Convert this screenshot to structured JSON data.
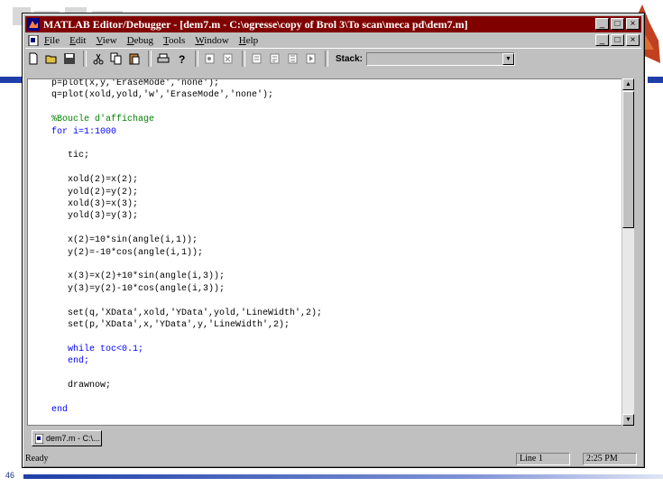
{
  "window": {
    "title": "MATLAB Editor/Debugger - [dem7.m - C:\\ogresse\\copy of Brol 3\\To scan\\meca pd\\dem7.m]",
    "controls": [
      "_",
      "□",
      "×"
    ],
    "doc_controls": [
      "_",
      "□",
      "×"
    ]
  },
  "menu": {
    "items": [
      {
        "first": "F",
        "rest": "ile"
      },
      {
        "first": "E",
        "rest": "dit"
      },
      {
        "first": "V",
        "rest": "iew"
      },
      {
        "first": "D",
        "rest": "ebug"
      },
      {
        "first": "T",
        "rest": "ools"
      },
      {
        "first": "W",
        "rest": "indow"
      },
      {
        "first": "H",
        "rest": "elp"
      }
    ]
  },
  "toolbar": {
    "stack_label": "Stack:",
    "stack_value": ""
  },
  "code": [
    {
      "text": "p=plot(x,y,'EraseMode','none');",
      "cls": ""
    },
    {
      "text": "q=plot(xold,yold,'w','EraseMode','none');",
      "cls": ""
    },
    {
      "text": "",
      "cls": ""
    },
    {
      "text": "%Boucle d'affichage",
      "cls": "cm"
    },
    {
      "text": "for i=1:1000",
      "cls": "kw"
    },
    {
      "text": "",
      "cls": ""
    },
    {
      "text": "   tic;",
      "cls": ""
    },
    {
      "text": "",
      "cls": ""
    },
    {
      "text": "   xold(2)=x(2);",
      "cls": ""
    },
    {
      "text": "   yold(2)=y(2);",
      "cls": ""
    },
    {
      "text": "   xold(3)=x(3);",
      "cls": ""
    },
    {
      "text": "   yold(3)=y(3);",
      "cls": ""
    },
    {
      "text": "",
      "cls": ""
    },
    {
      "text": "   x(2)=10*sin(angle(i,1));",
      "cls": ""
    },
    {
      "text": "   y(2)=-10*cos(angle(i,1));",
      "cls": ""
    },
    {
      "text": "",
      "cls": ""
    },
    {
      "text": "   x(3)=x(2)+10*sin(angle(i,3));",
      "cls": ""
    },
    {
      "text": "   y(3)=y(2)-10*cos(angle(i,3));",
      "cls": ""
    },
    {
      "text": "",
      "cls": ""
    },
    {
      "text": "   set(q,'XData',xold,'YData',yold,'LineWidth',2);",
      "cls": ""
    },
    {
      "text": "   set(p,'XData',x,'YData',y,'LineWidth',2);",
      "cls": ""
    },
    {
      "text": "",
      "cls": ""
    },
    {
      "text": "   while toc<0.1;",
      "cls": "kw"
    },
    {
      "text": "   end;",
      "cls": "kw"
    },
    {
      "text": "",
      "cls": ""
    },
    {
      "text": "   drawnow;",
      "cls": ""
    },
    {
      "text": "",
      "cls": ""
    },
    {
      "text": "end",
      "cls": "kw"
    }
  ],
  "taskbar": {
    "tab_label": "dem7.m - C:\\..."
  },
  "statusbar": {
    "ready": "Ready",
    "line": "Line 1",
    "time": "2:25 PM"
  },
  "slide": {
    "page_number": "46"
  },
  "colors": {
    "titlebar": "#800000",
    "keyword": "#0000ff",
    "comment": "#008000",
    "footer_bar": "#1f3fa8"
  }
}
